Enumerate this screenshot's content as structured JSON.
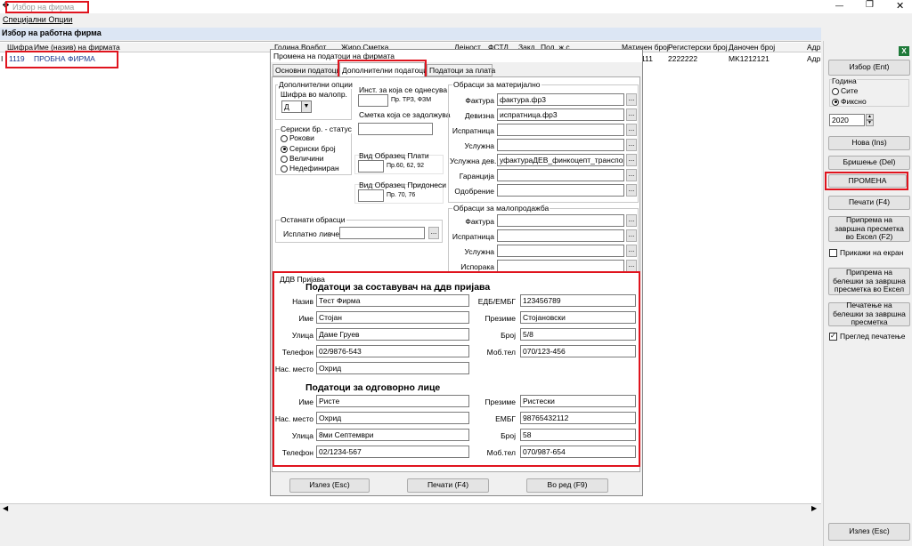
{
  "window": {
    "search_placeholder": "Избор на фирма"
  },
  "menu": {
    "special": "Специјални Опции"
  },
  "section_title": "Избор на работна фирма",
  "grid": {
    "columns": [
      "Шифра",
      "Име (назив) на фирмата",
      "Година",
      "Вработ.",
      "Жиро Сметка",
      "Дејност",
      "ФСТД",
      "Закл.",
      "Пол. ж.с.",
      "Матичен број",
      "Регистерски број",
      "Даночен број",
      "Адр"
    ],
    "row": {
      "code": "1119",
      "name": "ПРОБНА ФИРМА",
      "matichen": "111",
      "registerski": "2222222",
      "danochen": "MK1212121",
      "adr": "Адр"
    }
  },
  "dialog": {
    "title": "Промена на податоци на фирмата",
    "tabs": [
      "Основни податоци",
      "Дополнителни податоци",
      "Податоци за плата"
    ],
    "extra_options": {
      "title": "Дополнителни опции",
      "code_label": "Шифра во малопр.",
      "code_value": "Д"
    },
    "inst_label": "Инст. за која се однесува",
    "inst_hint": "Пр. ТРЗ, ФЗМ",
    "account_label": "Сметка која се задолжува",
    "serial": {
      "title": "Сериски бр. - статус",
      "options": [
        "Рокови",
        "Сериски број",
        "Величини",
        "Недефиниран"
      ]
    },
    "pay_form": {
      "label": "Вид Образец Плати",
      "hint": "Пр.60, 62, 92"
    },
    "contrib_form": {
      "label": "Вид Образец Придонеси",
      "hint": "Пр. 70, 76"
    },
    "other_forms": {
      "title": "Останати обрасци",
      "payslip_label": "Исплатно ливче"
    },
    "material_forms": {
      "title": "Обрасци за материјално",
      "rows": [
        {
          "label": "Фактура",
          "value": "фактура.фр3"
        },
        {
          "label": "Девизна",
          "value": "испратница.фр3"
        },
        {
          "label": "Испратница",
          "value": ""
        },
        {
          "label": "Услужна",
          "value": ""
        },
        {
          "label": "Услужна дев.",
          "value": "уфактураДЕВ_финкоцепт_транспорт.ф"
        },
        {
          "label": "Гаранција",
          "value": ""
        },
        {
          "label": "Одобрение",
          "value": ""
        }
      ]
    },
    "retail_forms": {
      "title": "Обрасци за малопродажба",
      "rows": [
        {
          "label": "Фактура",
          "value": ""
        },
        {
          "label": "Испратница",
          "value": ""
        },
        {
          "label": "Услужна",
          "value": ""
        },
        {
          "label": "Испорака",
          "value": ""
        }
      ]
    },
    "ddv": {
      "group_title": "ДДВ Пријава",
      "composer_title": "Податоци за составувач на ддв пријава",
      "composer": {
        "name_label": "Назив",
        "name": "Тест Фирма",
        "edb_label": "ЕДБ/ЕМБГ",
        "edb": "123456789",
        "first_label": "Име",
        "first": "Стојан",
        "last_label": "Презиме",
        "last": "Стојановски",
        "street_label": "Улица",
        "street": "Даме Груев",
        "num_label": "Број",
        "num": "5/8",
        "phone_label": "Телефон",
        "phone": "02/9876-543",
        "mob_label": "Моб.тел",
        "mob": "070/123-456",
        "city_label": "Нас. место",
        "city": "Охрид"
      },
      "responsible_title": "Податоци за одговорно лице",
      "responsible": {
        "first_label": "Име",
        "first": "Ристе",
        "last_label": "Презиме",
        "last": "Ристески",
        "city_label": "Нас. место",
        "city": "Охрид",
        "embg_label": "ЕМБГ",
        "embg": "98765432112",
        "street_label": "Улица",
        "street": "8ми Септември",
        "num_label": "Број",
        "num": "58",
        "phone_label": "Телефон",
        "phone": "02/1234-567",
        "mob_label": "Моб.тел",
        "mob": "070/987-654"
      }
    },
    "buttons": {
      "exit": "Излез (Esc)",
      "print": "Печати (F4)",
      "ok": "Во ред (F9)"
    }
  },
  "right_panel": {
    "select_btn": "Избор (Ent)",
    "year": {
      "title": "Година",
      "all": "Сите",
      "fixed": "Фиксно",
      "value": "2020"
    },
    "new_btn": "Нова (Ins)",
    "delete_btn": "Бришење (Del)",
    "change_btn": "ПРОМЕНА",
    "print_btn": "Печати (F4)",
    "prep_excel_btn": "Припрема на завршна пресметка во Ексел (F2)",
    "show_screen": "Прикажи на екран",
    "notes_excel_btn": "Припрема на белешки за завршна пресметка во Ексел",
    "notes_print_btn": "Печатење на белешки за завршна пресметка",
    "print_preview": "Преглед печатење",
    "exit_btn": "Излез (Esc)"
  }
}
